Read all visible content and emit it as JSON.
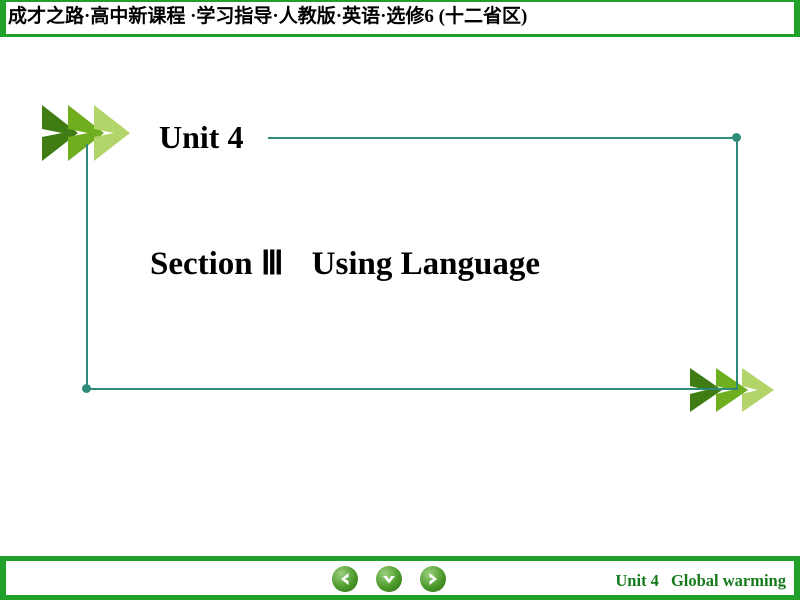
{
  "header": {
    "title": "成才之路·高中新课程 ·学习指导·人教版·英语·选修6 (十二省区)"
  },
  "main": {
    "unit_label": "Unit 4",
    "section_label": "Section Ⅲ",
    "section_name": "Using Language"
  },
  "footer": {
    "unit_label": "Unit 4",
    "topic_label": "Global warming"
  },
  "nav": {
    "prev": "prev-arrow-icon",
    "down": "down-arrow-icon",
    "next": "next-arrow-icon"
  },
  "colors": {
    "banner_green": "#22a12a",
    "frame_teal": "#2e8b7a",
    "footer_text_green": "#167a1b",
    "chevron_dark": "#3f7d14",
    "chevron_mid": "#6fae1e",
    "chevron_light": "#a7cf4a"
  }
}
